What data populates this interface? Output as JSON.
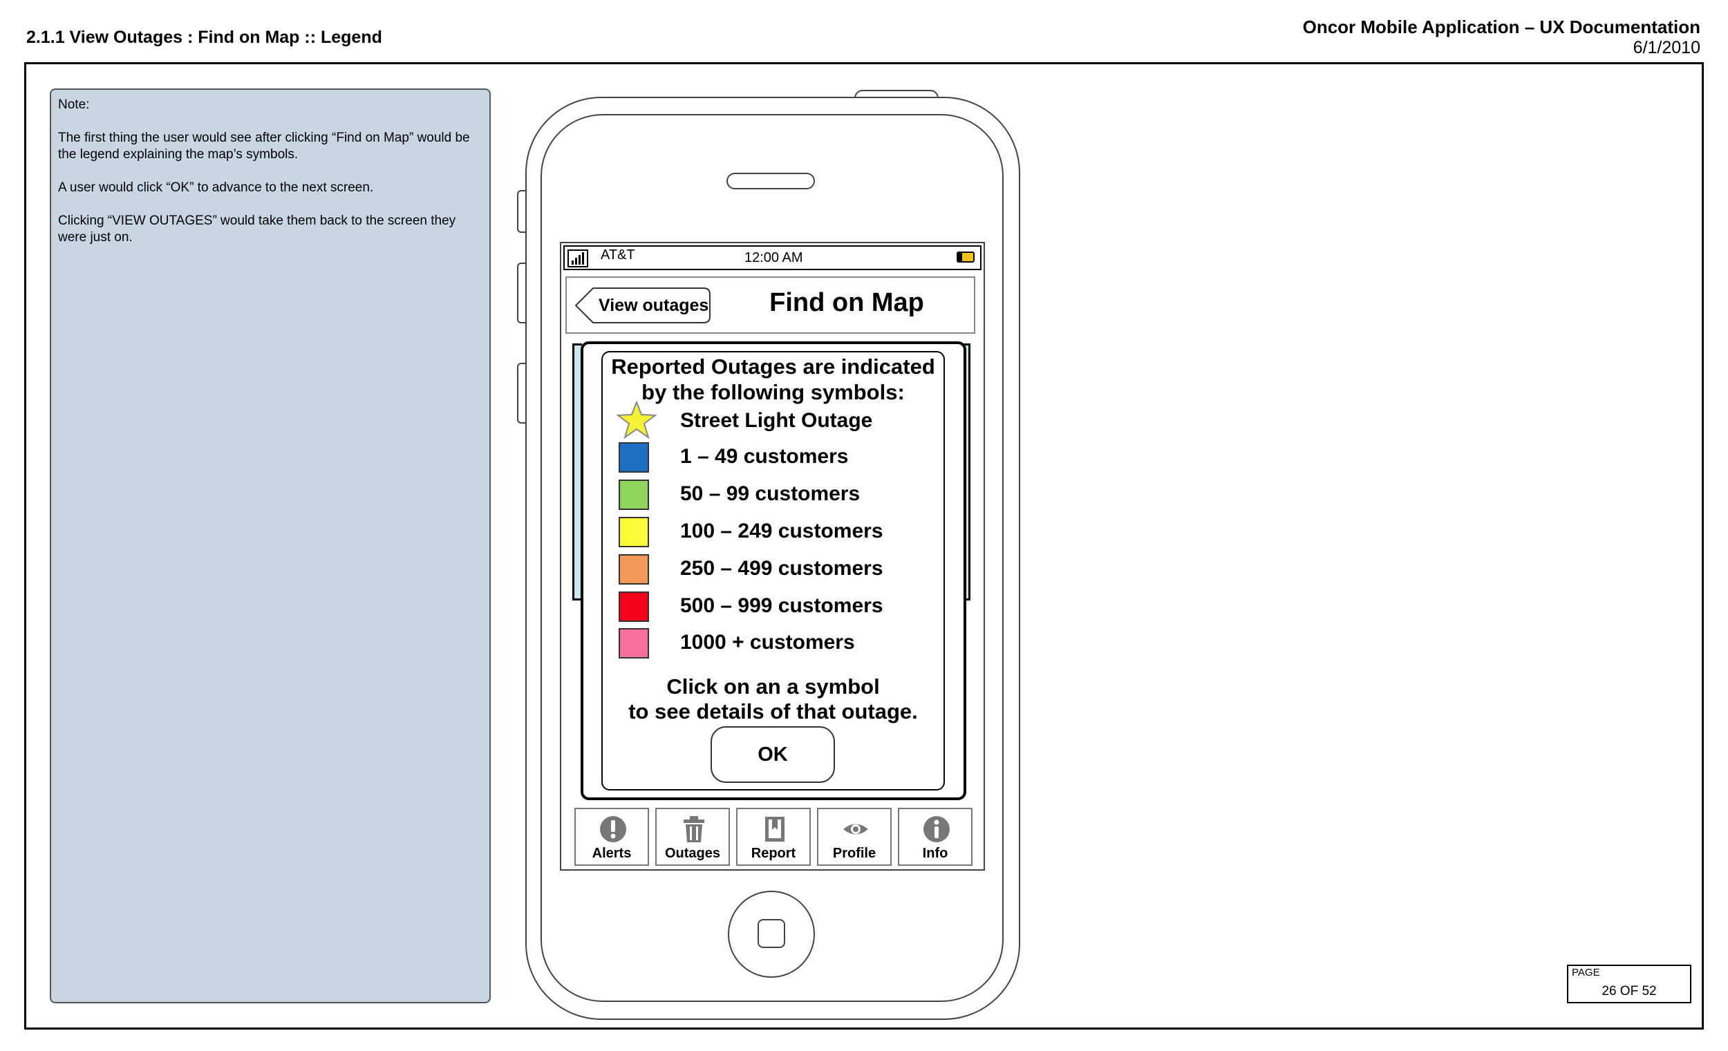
{
  "header": {
    "title": "2.1.1 View Outages : Find on Map :: Legend",
    "app": "Oncor Mobile Application – UX Documentation",
    "date": "6/1/2010"
  },
  "note": {
    "label": "Note:",
    "paragraphs": [
      "The first thing the user would see after clicking “Find on Map” would be the legend explaining the map’s symbols.",
      "A user would click “OK” to advance to the next screen.",
      "Clicking “VIEW OUTAGES” would take them back to the screen they were just on."
    ]
  },
  "status_bar": {
    "carrier": "AT&T",
    "time": "12:00 AM"
  },
  "nav": {
    "back_label": "View outages",
    "title": "Find on Map"
  },
  "legend": {
    "heading_line1": "Reported Outages are indicated",
    "heading_line2": "by the following symbols:",
    "items": [
      {
        "label": "Street Light Outage",
        "symbol": "star-icon",
        "color": "#f7f135"
      },
      {
        "label": "1 – 49 customers",
        "symbol": "square",
        "color": "#1f6fc4"
      },
      {
        "label": "50 – 99 customers",
        "symbol": "square",
        "color": "#8ed35a"
      },
      {
        "label": "100 – 249 customers",
        "symbol": "square",
        "color": "#fbfb3a"
      },
      {
        "label": "250 – 499 customers",
        "symbol": "square",
        "color": "#f39a5a"
      },
      {
        "label": "500 – 999 customers",
        "symbol": "square",
        "color": "#f5021a"
      },
      {
        "label": "1000 + customers",
        "symbol": "square",
        "color": "#f76f9e"
      }
    ],
    "hint_line1": "Click on an a symbol",
    "hint_line2": "to see details of that outage.",
    "ok_label": "OK"
  },
  "tabs": [
    {
      "label": "Alerts",
      "icon": "alert-icon"
    },
    {
      "label": "Outages",
      "icon": "trash-icon"
    },
    {
      "label": "Report",
      "icon": "report-icon"
    },
    {
      "label": "Profile",
      "icon": "eye-icon"
    },
    {
      "label": "Info",
      "icon": "info-icon"
    }
  ],
  "page": {
    "label": "PAGE",
    "number": "26 OF 52"
  }
}
